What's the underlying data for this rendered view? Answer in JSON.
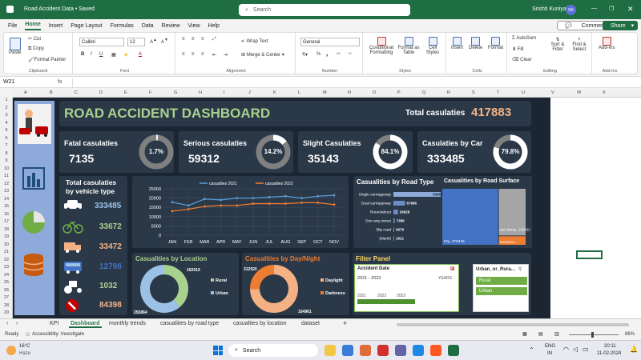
{
  "window": {
    "title": "Road Accident Data • Saved",
    "search_placeholder": "Search",
    "user_name": "Srishti Kuniyal",
    "user_initials": "SK"
  },
  "menu": {
    "items": [
      "File",
      "Home",
      "Insert",
      "Page Layout",
      "Formulas",
      "Data",
      "Review",
      "View",
      "Help"
    ],
    "active": "Home",
    "comments_label": "Comments",
    "share_label": "Share"
  },
  "ribbon": {
    "clipboard": {
      "paste": "Paste",
      "cut": "Cut",
      "copy": "Copy",
      "format_painter": "Format Painter",
      "label": "Clipboard"
    },
    "font": {
      "name": "Calibri",
      "size": "12",
      "label": "Font"
    },
    "alignment": {
      "wrap": "Wrap Text",
      "merge": "Merge & Center",
      "label": "Alignment"
    },
    "number": {
      "format": "General",
      "label": "Number"
    },
    "styles": {
      "conditional": "Conditional Formatting",
      "format_table": "Format as Table",
      "cell_styles": "Cell Styles",
      "label": "Styles"
    },
    "cells": {
      "insert": "Insert",
      "delete": "Delete",
      "format": "Format",
      "label": "Cells"
    },
    "editing": {
      "autosum": "AutoSum",
      "fill": "Fill",
      "clear": "Clear",
      "sort": "Sort & Filter",
      "find": "Find & Select",
      "label": "Editing"
    },
    "addins": {
      "addins": "Add-ins",
      "label": "Add-ins"
    }
  },
  "formula_bar": {
    "cell_ref": "W21",
    "fx": "fx",
    "value": ""
  },
  "columns": [
    "A",
    "B",
    "C",
    "D",
    "E",
    "F",
    "G",
    "H",
    "I",
    "J",
    "K",
    "L",
    "M",
    "N",
    "O",
    "P",
    "Q",
    "R",
    "S",
    "T",
    "U",
    "V",
    "W",
    "X"
  ],
  "rows": [
    "1",
    "2",
    "3",
    "4",
    "5",
    "6",
    "7",
    "8",
    "9",
    "10",
    "11",
    "12",
    "13",
    "14",
    "15",
    "16",
    "17",
    "18",
    "19",
    "20",
    "21",
    "22",
    "23",
    "24",
    "25",
    "26",
    "27",
    "28",
    "29"
  ],
  "dashboard": {
    "title": "ROAD ACCIDENT DASHBOARD",
    "total_label": "Total casulaties",
    "total_value": "417883",
    "kpis": [
      {
        "label": "Fatal casulaties",
        "value": "7135",
        "pct": "1.7%",
        "fraction": 0.017
      },
      {
        "label": "Serious casulaties",
        "value": "59312",
        "pct": "14.2%",
        "fraction": 0.142
      },
      {
        "label": "Slight Casulaties",
        "value": "35143",
        "pct": "84.1%",
        "fraction": 0.841
      },
      {
        "label": "Casulaties by Car",
        "value": "333485",
        "pct": "79.8%",
        "fraction": 0.798
      }
    ],
    "vehicle": {
      "title_line1": "Total casulaties",
      "title_line2": "by vehicle type",
      "items": [
        {
          "icon": "car-icon",
          "value": "333485",
          "color": "#9bc2e6"
        },
        {
          "icon": "bicycle-icon",
          "value": "33672",
          "color": "#a9d18e"
        },
        {
          "icon": "truck-icon",
          "value": "33472",
          "color": "#f4b183"
        },
        {
          "icon": "bus-icon",
          "value": "12798",
          "color": "#4472c4"
        },
        {
          "icon": "tractor-icon",
          "value": "1032",
          "color": "#a9d18e"
        },
        {
          "icon": "no-entry-icon",
          "value": "84398",
          "color": "#f4b183"
        }
      ]
    },
    "road_type": {
      "title": "Casualities by Road Type"
    },
    "road_surface": {
      "title": "Casualities by Road Surface"
    },
    "location": {
      "title": "Casualities by Location"
    },
    "daynight": {
      "title": "Casualities by Day/Night"
    },
    "filter": {
      "title": "Filter Panel",
      "accident_date": "Accident Date",
      "date_range": "2021 - 2023",
      "years": "YEARS",
      "timeline_years": [
        "2021",
        "2022",
        "2023"
      ],
      "slicer_title": "Urban_or_Rura...",
      "slicer_items": [
        "Rural",
        "Urban"
      ]
    }
  },
  "chart_data": [
    {
      "type": "line",
      "categories": [
        "JAN",
        "FEB",
        "MAR",
        "APR",
        "MAY",
        "JUN",
        "JUL",
        "AUG",
        "SEP",
        "OCT",
        "NOV"
      ],
      "series": [
        {
          "name": "casualties 2021",
          "values": [
            17800,
            16000,
            19500,
            19000,
            20000,
            20000,
            20500,
            21000,
            20000,
            21000,
            21500
          ],
          "color": "#5b9bd5"
        },
        {
          "name": "casualties 2022",
          "values": [
            13000,
            14000,
            15500,
            16000,
            16000,
            17000,
            17000,
            17000,
            17500,
            17500,
            16500
          ],
          "color": "#ed7d31"
        }
      ],
      "ylim": [
        0,
        25000
      ],
      "yticks": [
        "25000",
        "20000",
        "15000",
        "10000",
        "5000",
        "0"
      ]
    },
    {
      "type": "bar",
      "categories": [
        "Single carriageway",
        "Dual carriageway",
        "Roundabout",
        "One way street",
        "Slip road",
        "(blank)"
      ],
      "values": [
        309698,
        67986,
        26828,
        7389,
        4679,
        1921
      ],
      "labels": [
        "309698",
        "67986",
        "26828",
        "7389",
        "4679",
        "1921"
      ]
    },
    {
      "type": "area",
      "categories": [
        "Dry",
        "wet /damp",
        "Snow/Ice..."
      ],
      "labels": [
        "Dry, 279445",
        "wet /damp, 115261",
        "Snow/Ice..."
      ],
      "values": [
        279445,
        115261,
        23177
      ]
    },
    {
      "type": "pie",
      "categories": [
        "Rural",
        "Urban"
      ],
      "values": [
        162019,
        255864
      ],
      "labels": [
        "162019",
        "255864"
      ],
      "colors": [
        "#a9d18e",
        "#9bc2e6"
      ]
    },
    {
      "type": "pie",
      "categories": [
        "Daylight",
        "Darkness"
      ],
      "values": [
        312920,
        104961
      ],
      "labels": [
        "312920",
        "104961"
      ],
      "colors": [
        "#f4b183",
        "#ed7d31"
      ]
    }
  ],
  "sheets": {
    "tabs": [
      "KPI",
      "Dashboard",
      "monthly trends",
      "casualities by road type",
      "casualties by location",
      "dataset"
    ],
    "active": "Dashboard"
  },
  "status": {
    "ready": "Ready",
    "accessibility": "Accessibility: Investigate",
    "zoom": "86%"
  },
  "taskbar": {
    "temp": "16°C",
    "weather": "Haze",
    "search": "Search",
    "lang": "ENG",
    "region": "IN",
    "time": "20:11",
    "date": "11-02-2024"
  }
}
